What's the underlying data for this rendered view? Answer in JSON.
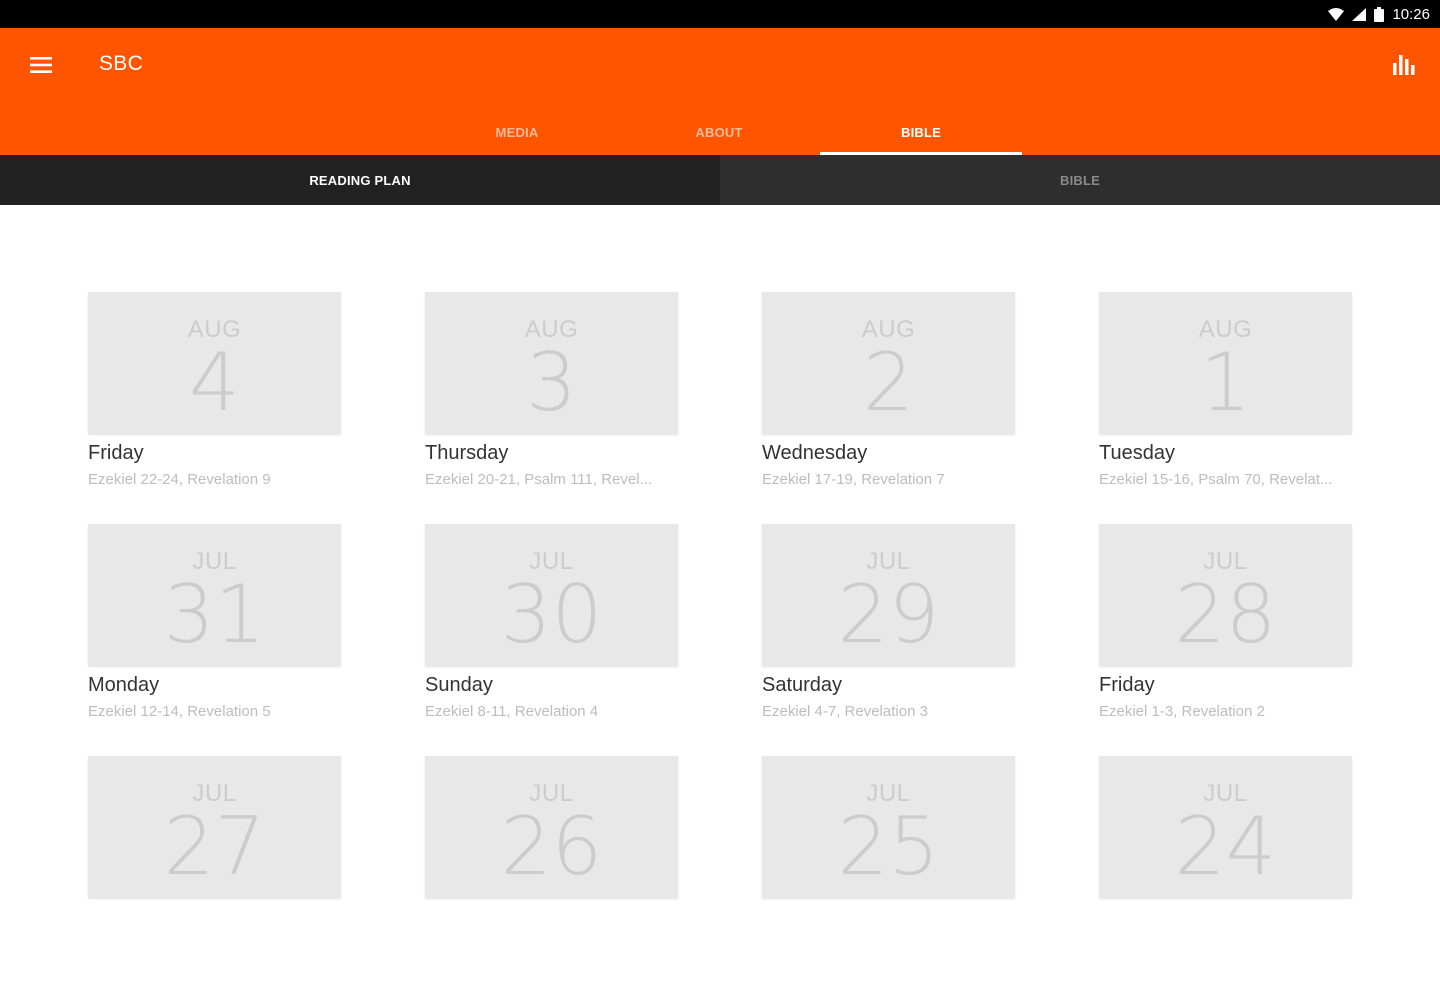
{
  "status_bar": {
    "time": "10:26"
  },
  "app_bar": {
    "title": "SBC"
  },
  "tabs": [
    {
      "label": "MEDIA"
    },
    {
      "label": "ABOUT"
    },
    {
      "label": "BIBLE"
    }
  ],
  "sub_tabs": [
    {
      "label": "READING PLAN"
    },
    {
      "label": "BIBLE"
    }
  ],
  "readings": [
    {
      "month": "AUG",
      "day": "4",
      "weekday": "Friday",
      "passage": "Ezekiel 22-24, Revelation 9"
    },
    {
      "month": "AUG",
      "day": "3",
      "weekday": "Thursday",
      "passage": "Ezekiel 20-21, Psalm 111, Revel..."
    },
    {
      "month": "AUG",
      "day": "2",
      "weekday": "Wednesday",
      "passage": "Ezekiel 17-19, Revelation 7"
    },
    {
      "month": "AUG",
      "day": "1",
      "weekday": "Tuesday",
      "passage": "Ezekiel 15-16, Psalm 70, Revelat..."
    },
    {
      "month": "JUL",
      "day": "31",
      "weekday": "Monday",
      "passage": "Ezekiel 12-14, Revelation 5"
    },
    {
      "month": "JUL",
      "day": "30",
      "weekday": "Sunday",
      "passage": "Ezekiel 8-11, Revelation 4"
    },
    {
      "month": "JUL",
      "day": "29",
      "weekday": "Saturday",
      "passage": "Ezekiel 4-7, Revelation 3"
    },
    {
      "month": "JUL",
      "day": "28",
      "weekday": "Friday",
      "passage": "Ezekiel 1-3, Revelation 2"
    },
    {
      "month": "JUL",
      "day": "27",
      "weekday": "",
      "passage": ""
    },
    {
      "month": "JUL",
      "day": "26",
      "weekday": "",
      "passage": ""
    },
    {
      "month": "JUL",
      "day": "25",
      "weekday": "",
      "passage": ""
    },
    {
      "month": "JUL",
      "day": "24",
      "weekday": "",
      "passage": ""
    }
  ],
  "colors": {
    "primary": "#ff5500",
    "status_bar": "#000000",
    "sub_tab_active": "#222222",
    "sub_tab_inactive": "#2e2e2e"
  }
}
